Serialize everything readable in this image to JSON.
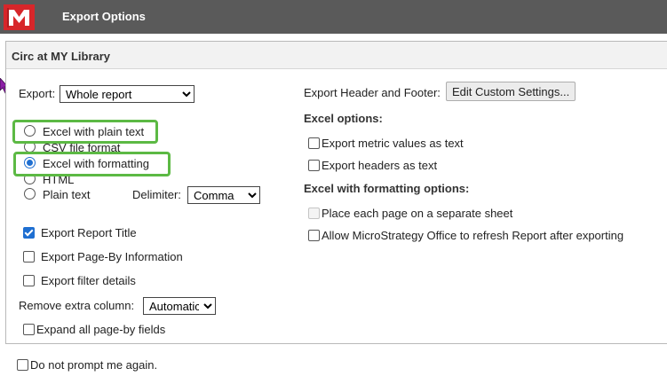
{
  "window": {
    "title": "Export Options",
    "logo_icon": "microstrategy-logo-icon"
  },
  "panel": {
    "title": "Circ at MY Library"
  },
  "export": {
    "label": "Export:",
    "selected": "Whole report",
    "options": [
      "Whole report"
    ]
  },
  "formats": [
    {
      "label": "Excel with plain text",
      "checked": false
    },
    {
      "label": "CSV file format",
      "checked": false
    },
    {
      "label": "Excel with formatting",
      "checked": true
    },
    {
      "label": "HTML",
      "checked": false
    },
    {
      "label": "Plain text",
      "checked": false
    }
  ],
  "delimiter": {
    "label": "Delimiter:",
    "selected": "Comma"
  },
  "left_checks": [
    {
      "label": "Export Report Title",
      "checked": true
    },
    {
      "label": "Export Page-By Information",
      "checked": false
    },
    {
      "label": "Export filter details",
      "checked": false
    }
  ],
  "remove_column": {
    "label": "Remove extra column:",
    "selected": "Automatic"
  },
  "expand": {
    "label": "Expand all page-by fields",
    "checked": false
  },
  "header_footer": {
    "label": "Export Header and Footer:",
    "button": "Edit Custom Settings..."
  },
  "excel_options": {
    "heading": "Excel options:",
    "items": [
      {
        "label": "Export metric values as text",
        "checked": false
      },
      {
        "label": "Export headers as text",
        "checked": false
      }
    ]
  },
  "formatting_options": {
    "heading": "Excel with formatting options:",
    "items": [
      {
        "label": "Place each page on a separate sheet",
        "checked": false,
        "disabled": true
      },
      {
        "label": "Allow MicroStrategy Office to refresh Report after exporting",
        "checked": false,
        "disabled": false
      }
    ]
  },
  "footer": {
    "label": "Do not prompt me again."
  },
  "colors": {
    "titlebar": "#5a5a5a",
    "brand": "#d7262a",
    "highlight": "#5cb944",
    "accent": "#1f6fd1"
  }
}
